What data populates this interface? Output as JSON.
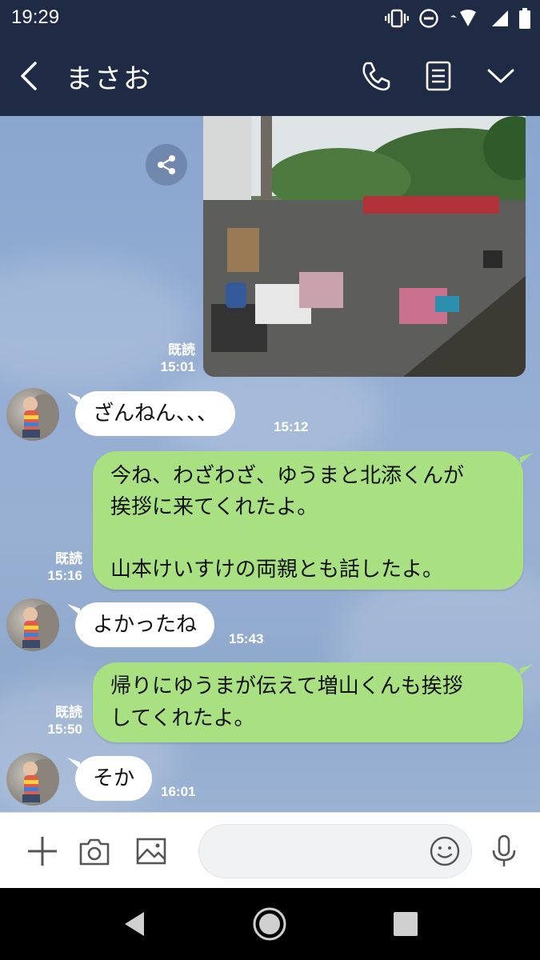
{
  "status_bar": {
    "time": "19:29",
    "icons": [
      "vibrate-icon",
      "do-not-disturb-icon",
      "wifi-icon",
      "signal-icon",
      "battery-icon"
    ]
  },
  "header": {
    "contact_name": "まさお",
    "icons": [
      "back-icon",
      "phone-icon",
      "notes-icon",
      "chevron-down-icon"
    ]
  },
  "messages": [
    {
      "type": "image",
      "side": "right",
      "read": "既読",
      "time": "15:01",
      "description_icon": "share-icon"
    },
    {
      "type": "text",
      "side": "left",
      "text": "ざんねん、、、",
      "time": "15:12"
    },
    {
      "type": "text",
      "side": "right",
      "text": "今ね、わざわざ、ゆうまと北添くんが\n挨拶に来てくれたよ。\n\n山本けいすけの両親とも話したよ。",
      "read": "既読",
      "time": "15:16"
    },
    {
      "type": "text",
      "side": "left",
      "text": "よかったね",
      "time": "15:43"
    },
    {
      "type": "text",
      "side": "right",
      "text": "帰りにゆうまが伝えて増山くんも挨拶\nしてくれたよ。",
      "read": "既読",
      "time": "15:50"
    },
    {
      "type": "text",
      "side": "left",
      "text": "そか",
      "time": "16:01"
    }
  ],
  "input_bar": {
    "placeholder": "",
    "icons": [
      "plus-icon",
      "camera-icon",
      "gallery-icon",
      "emoji-icon",
      "microphone-icon"
    ]
  },
  "nav_bar": {
    "icons": [
      "nav-back-icon",
      "nav-home-icon",
      "nav-recents-icon"
    ]
  },
  "colors": {
    "header_bg": "#1f2a44",
    "chat_bg": "#93acd1",
    "bubble_green": "#a9e182",
    "bubble_white": "#ffffff"
  }
}
